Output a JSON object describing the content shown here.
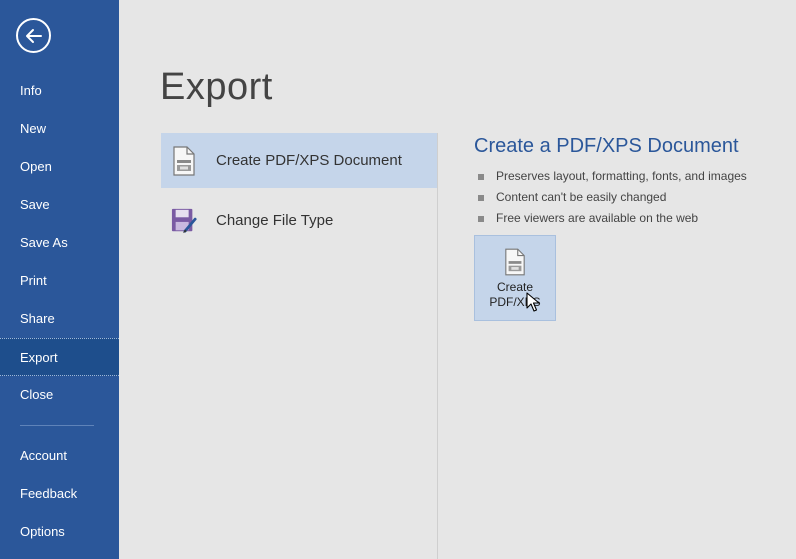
{
  "sidebar": {
    "items": [
      {
        "label": "Info"
      },
      {
        "label": "New"
      },
      {
        "label": "Open"
      },
      {
        "label": "Save"
      },
      {
        "label": "Save As"
      },
      {
        "label": "Print"
      },
      {
        "label": "Share"
      },
      {
        "label": "Export"
      },
      {
        "label": "Close"
      },
      {
        "label": "Account"
      },
      {
        "label": "Feedback"
      },
      {
        "label": "Options"
      }
    ],
    "active": "Export",
    "back_icon": "arrow-left-circle-icon"
  },
  "main": {
    "title": "Export",
    "options": [
      {
        "label": "Create PDF/XPS Document",
        "icon": "pdf-document-icon",
        "selected": true
      },
      {
        "label": "Change File Type",
        "icon": "save-as-filetype-icon",
        "selected": false
      }
    ],
    "detail": {
      "title": "Create a PDF/XPS Document",
      "bullets": [
        "Preserves layout, formatting, fonts, and images",
        "Content can't be easily changed",
        "Free viewers are available on the web"
      ],
      "button_label_line1": "Create",
      "button_label_line2": "PDF/XPS"
    }
  },
  "colors": {
    "sidebar_bg": "#2b579a",
    "accent": "#2b579a",
    "selected_bg": "#c5d5ea"
  }
}
